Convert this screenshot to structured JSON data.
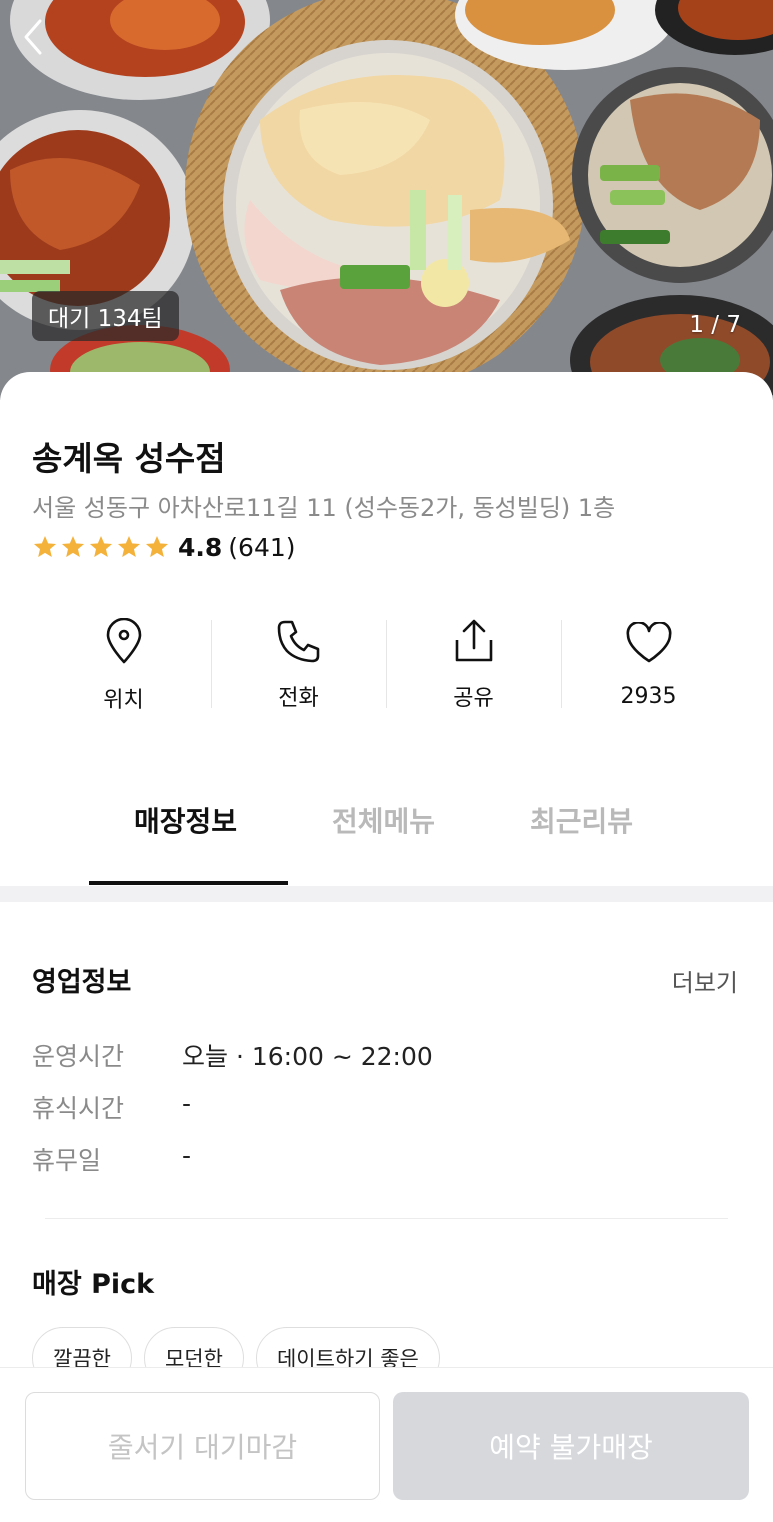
{
  "hero": {
    "wait_badge": "대기 134팀",
    "page_counter": "1 / 7"
  },
  "store": {
    "name": "송계옥 성수점",
    "address": "서울 성동구 아차산로11길 11 (성수동2가, 동성빌딩) 1층",
    "rating": "4.8",
    "review_count": "(641)",
    "stars": 5,
    "star_color": "#f4b23b"
  },
  "actions": [
    {
      "label": "위치",
      "icon": "location-pin-icon"
    },
    {
      "label": "전화",
      "icon": "phone-icon"
    },
    {
      "label": "공유",
      "icon": "share-icon"
    },
    {
      "label": "2935",
      "icon": "heart-icon"
    }
  ],
  "tabs": [
    {
      "label": "매장정보",
      "active": true
    },
    {
      "label": "전체메뉴",
      "active": false
    },
    {
      "label": "최근리뷰",
      "active": false
    }
  ],
  "business_info": {
    "title": "영업정보",
    "more": "더보기",
    "rows": [
      {
        "key": "운영시간",
        "value": "오늘 · 16:00 ~ 22:00"
      },
      {
        "key": "휴식시간",
        "value": "-"
      },
      {
        "key": "휴무일",
        "value": "-"
      }
    ]
  },
  "pick": {
    "title": "매장 Pick",
    "chips": [
      "깔끔한",
      "모던한",
      "데이트하기 좋은"
    ]
  },
  "bottom": {
    "queue_button": "줄서기 대기마감",
    "reserve_button": "예약 불가매장"
  }
}
